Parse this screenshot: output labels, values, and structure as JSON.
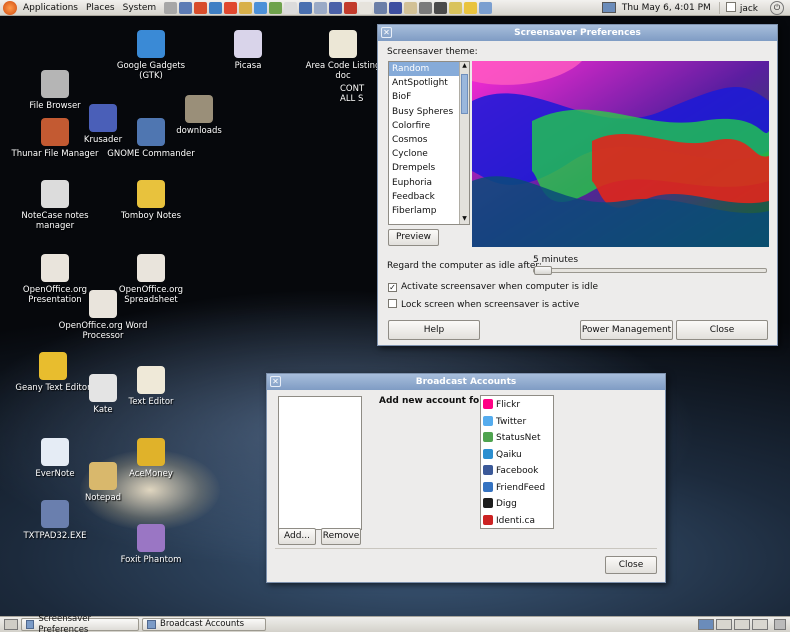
{
  "top_panel": {
    "menus": [
      "Applications",
      "Places",
      "System"
    ],
    "clock": "Thu May  6,  4:01 PM",
    "user": "jack"
  },
  "desktop_icons": [
    {
      "label": "Google Gadgets (GTK)",
      "color": "#3a8ad6"
    },
    {
      "label": "Picasa",
      "color": "#d9d4ea"
    },
    {
      "label": "Area Code Listing doc",
      "color": "#ece7d6"
    },
    {
      "label": "CONT ALL S",
      "color": ""
    },
    {
      "label": "File Browser",
      "color": "#b5b5b5"
    },
    {
      "label": "Krusader",
      "color": "#4a5fb8"
    },
    {
      "label": "downloads",
      "color": "#9a8f79"
    },
    {
      "label": "Thunar File Manager",
      "color": "#c35a32"
    },
    {
      "label": "GNOME Commander",
      "color": "#4f76b1"
    },
    {
      "label": "NoteCase notes manager",
      "color": "#dcdcdc"
    },
    {
      "label": "Tomboy Notes",
      "color": "#e8c23d"
    },
    {
      "label": "OpenOffice.org Presentation",
      "color": "#e9e4dc"
    },
    {
      "label": "OpenOffice.org Spreadsheet",
      "color": "#e9e4dc"
    },
    {
      "label": "OpenOffice.org Word Processor",
      "color": "#e9e4dc"
    },
    {
      "label": "Geany Text Editor",
      "color": "#e8bd2e"
    },
    {
      "label": "Kate",
      "color": "#e4e4e4"
    },
    {
      "label": "Text Editor",
      "color": "#efe9d8"
    },
    {
      "label": "EverNote",
      "color": "#e5ecf5"
    },
    {
      "label": "Notepad",
      "color": "#d9b86c"
    },
    {
      "label": "AceMoney",
      "color": "#e0b22a"
    },
    {
      "label": "TXTPAD32.EXE",
      "color": "#6a7fae"
    },
    {
      "label": "Foxit Phantom",
      "color": "#9a76c4"
    }
  ],
  "screensaver": {
    "title": "Screensaver Preferences",
    "theme_label": "Screensaver theme:",
    "themes": [
      "Random",
      "AntSpotlight",
      "BioF",
      "Busy Spheres",
      "Colorfire",
      "Cosmos",
      "Cyclone",
      "Drempels",
      "Euphoria",
      "Feedback",
      "Fiberlamp"
    ],
    "selected": "Random",
    "preview_button": "Preview",
    "idle_label": "Regard the computer as idle after:",
    "idle_value": "5 minutes",
    "idle_fraction": 0.0,
    "activate_label": "Activate screensaver when computer is idle",
    "activate_checked": true,
    "lock_label": "Lock screen when screensaver is active",
    "lock_checked": false,
    "help_button": "Help",
    "power_button": "Power Management",
    "close_button": "Close"
  },
  "broadcast": {
    "title": "Broadcast Accounts",
    "add_label": "Add new account for:",
    "accounts": [
      {
        "name": "Flickr",
        "icon": "flickr-icon",
        "color": "#ff0084"
      },
      {
        "name": "Twitter",
        "icon": "twitter-icon",
        "color": "#55acee"
      },
      {
        "name": "StatusNet",
        "icon": "statusnet-icon",
        "color": "#4fa34f"
      },
      {
        "name": "Qaiku",
        "icon": "qaiku-icon",
        "color": "#2c8fd0"
      },
      {
        "name": "Facebook",
        "icon": "facebook-icon",
        "color": "#3b5998"
      },
      {
        "name": "FriendFeed",
        "icon": "friendfeed-icon",
        "color": "#3573c1"
      },
      {
        "name": "Digg",
        "icon": "digg-icon",
        "color": "#1d1d1d"
      },
      {
        "name": "Identi.ca",
        "icon": "identica-icon",
        "color": "#cc2222"
      }
    ],
    "add_button": "Add...",
    "remove_button": "Remove",
    "close_button": "Close"
  },
  "taskbar": {
    "items": [
      "Screensaver Preferences",
      "Broadcast Accounts"
    ]
  }
}
